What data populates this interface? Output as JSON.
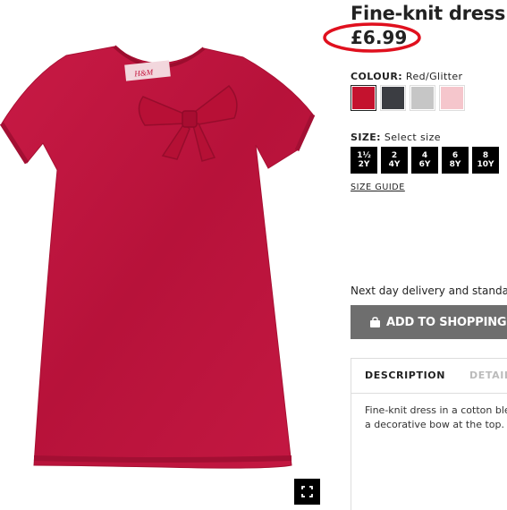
{
  "product": {
    "title": "Fine-knit dress",
    "price": "£6.99",
    "brand_tag": "H&M",
    "image_icon": "expand-icon"
  },
  "colour": {
    "label": "COLOUR:",
    "selected": "Red/Glitter",
    "swatches": [
      {
        "name": "red-glitter",
        "color": "#c4122e"
      },
      {
        "name": "dark-grey",
        "color": "#3b3d42"
      },
      {
        "name": "light-grey",
        "color": "#c6c6c6"
      },
      {
        "name": "light-pink",
        "color": "#f5c6cc"
      }
    ]
  },
  "size": {
    "label": "SIZE:",
    "hint": "Select size",
    "options": [
      {
        "top": "1½",
        "bottom": "2Y"
      },
      {
        "top": "2",
        "bottom": "4Y"
      },
      {
        "top": "4",
        "bottom": "6Y"
      },
      {
        "top": "6",
        "bottom": "8Y"
      },
      {
        "top": "8",
        "bottom": "10Y"
      }
    ],
    "guide": "SIZE GUIDE"
  },
  "delivery": "Next day delivery and standa",
  "cart": {
    "add_label": "ADD TO SHOPPING BA",
    "icon": "bag-icon"
  },
  "details": {
    "tabs": [
      "DESCRIPTION",
      "DETAIL"
    ],
    "text_lines": [
      "Fine-knit dress in a cotton blen",
      "a decorative bow at the top."
    ]
  },
  "colors": {
    "dress": "#c8173e",
    "annotation": "#e0101e",
    "button": "#6e6e6e"
  }
}
